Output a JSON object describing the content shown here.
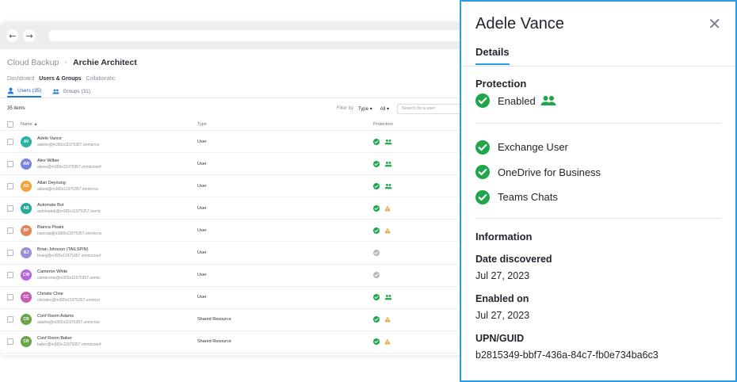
{
  "breadcrumb": {
    "root": "Cloud Backup",
    "current": "Archie Architect"
  },
  "subnav": [
    "Dashboard",
    "Users & Groups",
    "Collaboratic"
  ],
  "tabs": {
    "users": "Users (35)",
    "groups": "Groups (31)"
  },
  "toolbar": {
    "count": "35 items",
    "filter_label": "Filter by",
    "type_dropdown": "Type ▾",
    "all_dropdown": "All ▾",
    "search_placeholder": "Search for a user"
  },
  "table": {
    "headers": {
      "name": "Name ▲",
      "type": "Type",
      "protection": "Protection"
    },
    "rows": [
      {
        "initials": "AV",
        "color": "#2bb3a3",
        "name": "Adele Vance",
        "email": "adelev@m365x11975357.onmicros",
        "type": "User",
        "status": "ok",
        "extra": "group"
      },
      {
        "initials": "AW",
        "color": "#7b82e0",
        "name": "Alex Wilber",
        "email": "alexw@m365x11975357.onmicrosof",
        "type": "User",
        "status": "ok",
        "extra": "group"
      },
      {
        "initials": "AD",
        "color": "#f2a23a",
        "name": "Allan Deyoung",
        "email": "alland@m365x11975357.onmicros",
        "type": "User",
        "status": "ok",
        "extra": "group"
      },
      {
        "initials": "AB",
        "color": "#2aa79b",
        "name": "Automate Bot",
        "email": "automateb@m365x11975357.onmic",
        "type": "User",
        "status": "ok",
        "extra": "warn"
      },
      {
        "initials": "BP",
        "color": "#e0855a",
        "name": "Bianca Pisani",
        "email": "biancap@m365x11975357.onmicros",
        "type": "User",
        "status": "ok",
        "extra": "warn"
      },
      {
        "initials": "BJ",
        "color": "#9a8fd8",
        "name": "Brian Johnson (TAILSPIN)",
        "email": "brianj@m365x11975357.onmicrosof",
        "type": "User",
        "status": "grey",
        "extra": ""
      },
      {
        "initials": "CW",
        "color": "#b36ad8",
        "name": "Cameron White",
        "email": "cameronw@m365x11975357.onmic",
        "type": "User",
        "status": "grey",
        "extra": ""
      },
      {
        "initials": "CC",
        "color": "#c55fb5",
        "name": "Christie Cline",
        "email": "christiec@m365x11975357.onmicro",
        "type": "User",
        "status": "ok",
        "extra": "group"
      },
      {
        "initials": "CR",
        "color": "#6aa54a",
        "name": "Conf Room Adams",
        "email": "adams@m365x11975357.onmicros",
        "type": "Shared Resource",
        "status": "ok",
        "extra": "warn"
      },
      {
        "initials": "CR",
        "color": "#6aa54a",
        "name": "Conf Room Baker",
        "email": "baker@m365x11975357.onmicrosof",
        "type": "Shared Resource",
        "status": "ok",
        "extra": "warn"
      }
    ]
  },
  "panel": {
    "title": "Adele Vance",
    "tab": "Details",
    "protection_heading": "Protection",
    "protection_status": "Enabled",
    "services": [
      "Exchange User",
      "OneDrive for Business",
      "Teams Chats"
    ],
    "information_heading": "Information",
    "date_discovered_label": "Date discovered",
    "date_discovered": "Jul 27, 2023",
    "enabled_on_label": "Enabled on",
    "enabled_on": "Jul 27, 2023",
    "upn_label": "UPN/GUID",
    "upn": "b2815349-bbf7-436a-84c7-fb0e734ba6c3"
  },
  "colors": {
    "accent": "#2b9de8",
    "success": "#1fa64a",
    "warning": "#f2a23a",
    "muted": "#b5b9c0"
  }
}
